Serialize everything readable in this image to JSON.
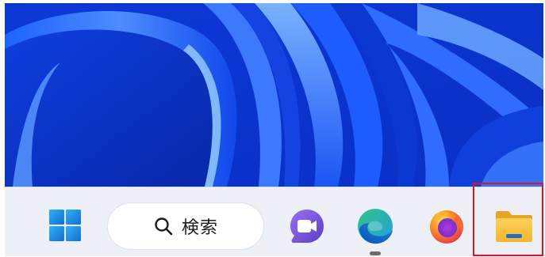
{
  "taskbar": {
    "start_label": "",
    "search": {
      "label": "検索",
      "icon": "search-icon"
    },
    "pinned": [
      {
        "name": "meet-now",
        "icon": "video-camera-icon"
      },
      {
        "name": "microsoft-edge",
        "icon": "edge-icon",
        "running": true
      },
      {
        "name": "firefox",
        "icon": "firefox-icon"
      },
      {
        "name": "file-explorer",
        "icon": "folder-icon",
        "highlighted": true
      }
    ]
  },
  "colors": {
    "highlight": "#e0141e",
    "taskbar_bg": "#edf0f6",
    "wallpaper_blue": "#0a3be0"
  }
}
